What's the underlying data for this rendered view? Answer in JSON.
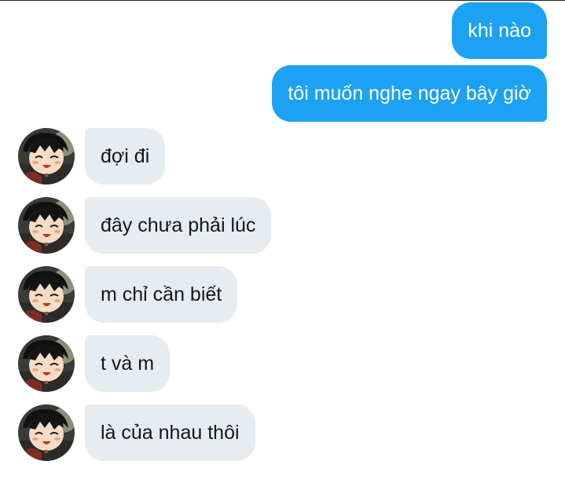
{
  "messages": [
    {
      "direction": "outgoing",
      "text": "khi nào"
    },
    {
      "direction": "outgoing",
      "text": "tôi muốn nghe ngay bây giờ"
    },
    {
      "direction": "incoming",
      "text": "đợi đi"
    },
    {
      "direction": "incoming",
      "text": "đây chưa phải lúc"
    },
    {
      "direction": "incoming",
      "text": "m chỉ cần biết"
    },
    {
      "direction": "incoming",
      "text": "t và m"
    },
    {
      "direction": "incoming",
      "text": "là của nhau thôi"
    }
  ],
  "colors": {
    "outgoing_bubble": "#1da1f2",
    "outgoing_text": "#ffffff",
    "incoming_bubble": "#e6ecf0",
    "incoming_text": "#14171a"
  },
  "icons": {
    "avatar": "anime-character-avatar-icon"
  }
}
